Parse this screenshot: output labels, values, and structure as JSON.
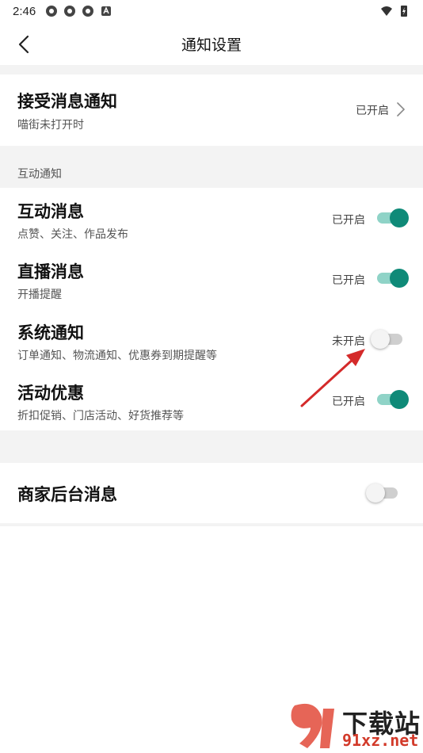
{
  "status_bar": {
    "time": "2:46"
  },
  "header": {
    "title": "通知设置"
  },
  "receive": {
    "title": "接受消息通知",
    "subtitle": "喵街未打开时",
    "status": "已开启"
  },
  "section_interactive": {
    "label": "互动通知"
  },
  "items": [
    {
      "title": "互动消息",
      "subtitle": "点赞、关注、作品发布",
      "status": "已开启",
      "enabled": true
    },
    {
      "title": "直播消息",
      "subtitle": "开播提醒",
      "status": "已开启",
      "enabled": true
    },
    {
      "title": "系统通知",
      "subtitle": "订单通知、物流通知、优惠券到期提醒等",
      "status": "未开启",
      "enabled": false
    },
    {
      "title": "活动优惠",
      "subtitle": "折扣促销、门店活动、好货推荐等",
      "status": "已开启",
      "enabled": true
    }
  ],
  "merchant": {
    "title": "商家后台消息",
    "enabled": false
  },
  "colors": {
    "accent": "#0f8a78",
    "accent_light": "#8fd3c7",
    "annotation": "#d42a2a",
    "background_gap": "#f3f3f3"
  },
  "watermark": {
    "brand": "下载站",
    "url": "91xz.net"
  }
}
